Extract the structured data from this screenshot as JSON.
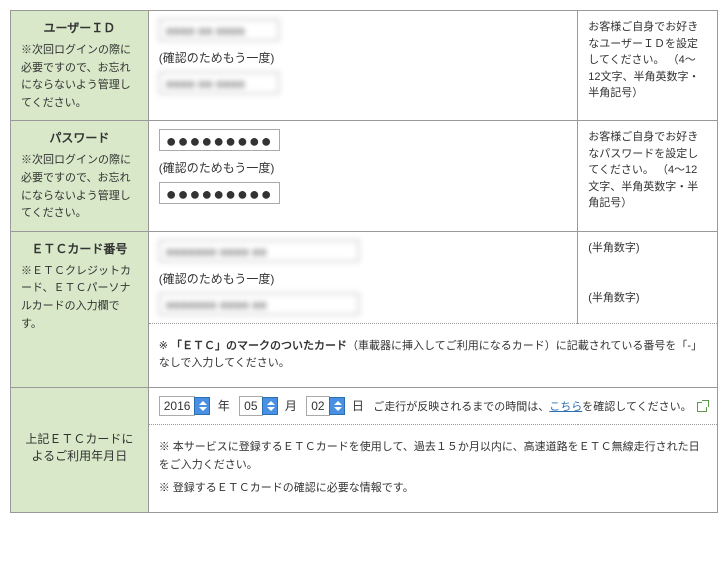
{
  "rows": {
    "userId": {
      "title": "ユーザーＩＤ",
      "note": "※次回ログインの際に必要ですので、お忘れにならないよう管理してください。",
      "inputValue": "■■■■ ■■ ■■■■",
      "confirmLabel": "(確認のためもう一度)",
      "confirmValue": "■■■■ ■■ ■■■■",
      "rightNote": "お客様ご自身でお好きなユーザーＩＤを設定してください。\n（4～12文字、半角英数字・半角記号）"
    },
    "password": {
      "title": "パスワード",
      "note": "※次回ログインの際に必要ですので、お忘れにならないよう管理してください。",
      "inputValue": "●●●●●●●●●",
      "confirmLabel": "(確認のためもう一度)",
      "confirmValue": "●●●●●●●●●",
      "rightNote": "お客様ご自身でお好きなパスワードを設定してください。\n（4～12文字、半角英数字・半角記号）"
    },
    "etcCard": {
      "title": "ＥＴＣカード番号",
      "note": "※ＥＴＣクレジットカード、ＥＴＣパーソナルカードの入力欄です。",
      "inputValue": "■■■■■■■ ■■■■ ■■",
      "confirmLabel": "(確認のためもう一度)",
      "confirmValue": "■■■■■■■ ■■■■ ■■",
      "rightNote1": "(半角数字)",
      "rightNote2": "(半角数字)",
      "footNotePrefix": "※ ",
      "footNoteBold": "「ＥＴＣ」のマークのついたカード",
      "footNoteRest": "（車載器に挿入してご利用になるカード）に記載されている番号を「-」なしで入力してください。"
    },
    "usageDate": {
      "title": "上記ＥＴＣカードによるご利用年月日",
      "year": "2016",
      "yearSuffix": "年",
      "month": "05",
      "monthSuffix": "月",
      "day": "02",
      "daySuffix": "日",
      "topNotePrefix": "ご走行が反映されるまでの時間は、",
      "topNoteLink": "こちら",
      "topNoteSuffix": "を確認してください。",
      "footNote1": "※ 本サービスに登録するＥＴＣカードを使用して、過去１５か月以内に、高速道路をＥＴＣ無線走行された日をご入力ください。",
      "footNote2": "※ 登録するＥＴＣカードの確認に必要な情報です。"
    }
  }
}
